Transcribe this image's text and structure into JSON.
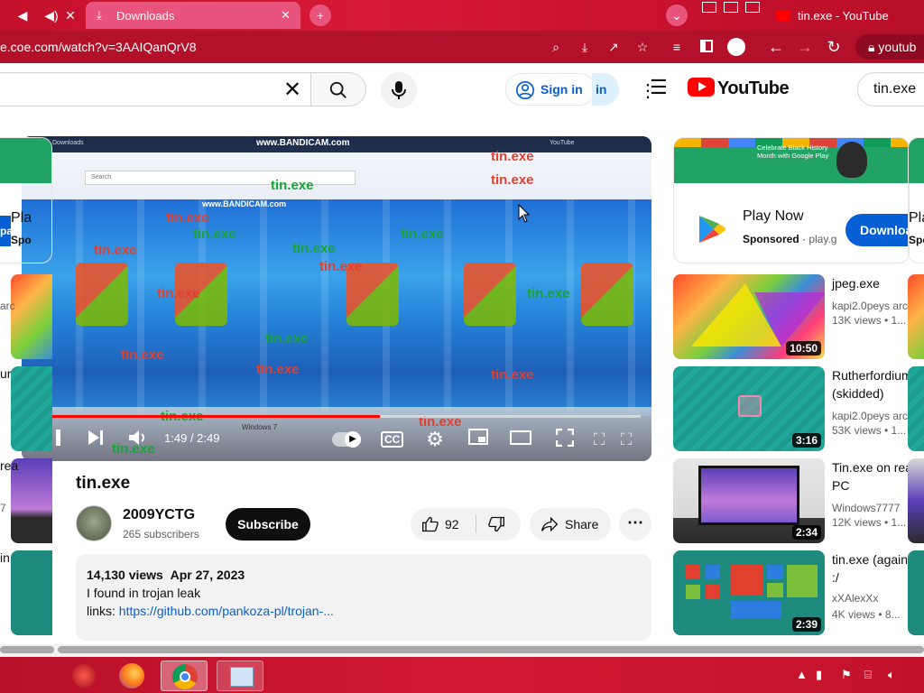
{
  "browser": {
    "tabs": [
      {
        "label": "Downloads"
      },
      {
        "label": "tin.exe - YouTube"
      }
    ],
    "url": "e.coe.com/watch?v=3AAIQanQrV8",
    "url_right": "youtub"
  },
  "masthead": {
    "signin_label": "Sign in",
    "signin_ghost": "in",
    "logo_text": "YouTube",
    "search_value_right": "tin.exe"
  },
  "player": {
    "time": "1:49 / 2:49",
    "progress_fraction": 0.574,
    "overlay_text": "tin.exe",
    "bandicam": "www.BANDICAM.com",
    "search_placeholder": "Search",
    "windows_label": "Windows 7",
    "youtube_label": "YouTube"
  },
  "video": {
    "title": "tin.exe",
    "channel": "2009YCTG",
    "subscribers": "265 subscribers",
    "subscribe_label": "Subscribe",
    "likes": "92",
    "share_label": "Share",
    "views": "14,130 views",
    "date": "Apr 27, 2023",
    "description_line1": "I found in trojan leak",
    "description_links_label": "links:",
    "description_link": "https://github.com/pankoza-pl/trojan-..."
  },
  "ad": {
    "banner_text": "Celebrate Black History Month with Google Play",
    "title": "Play Now",
    "sponsored": "Sponsored",
    "domain": "play.g",
    "cta": "Downloa"
  },
  "left_ghost": {
    "play_label": "Pla",
    "sponsored_label": "Spo",
    "cta": "pa",
    "items": [
      {
        "title": "",
        "meta": "arc"
      },
      {
        "title": "ur",
        "meta": ""
      },
      {
        "title": "rea",
        "meta": "7"
      },
      {
        "title": "in",
        "meta": ""
      }
    ]
  },
  "right_ghost": {
    "play_label": "Pla",
    "sponsored_label": "Spo"
  },
  "recommendations": [
    {
      "title": "jpeg.exe",
      "channel": "kapi2.0peys arc",
      "meta": "13K views  •  1...",
      "duration": "10:50",
      "thumb": "jpeg"
    },
    {
      "title": "Rutherfordium\n(skidded)",
      "channel": "kapi2.0peys arc",
      "meta": "53K views  •  1...",
      "duration": "3:16",
      "thumb": "teal"
    },
    {
      "title": "Tin.exe on rea\nPC",
      "channel": "Windows7777",
      "meta": "12K views  •  1...",
      "duration": "2:34",
      "thumb": "pc"
    },
    {
      "title": "tin.exe (again\n:/",
      "channel": "xXAlexXx",
      "meta": "4K views  •  8...",
      "duration": "2:39",
      "thumb": "win8"
    }
  ],
  "colors": {
    "chrome_red": "#c4102c",
    "yt_red": "#ff0000",
    "link_blue": "#065fd4",
    "subscribe_black": "#0f0f0f"
  }
}
